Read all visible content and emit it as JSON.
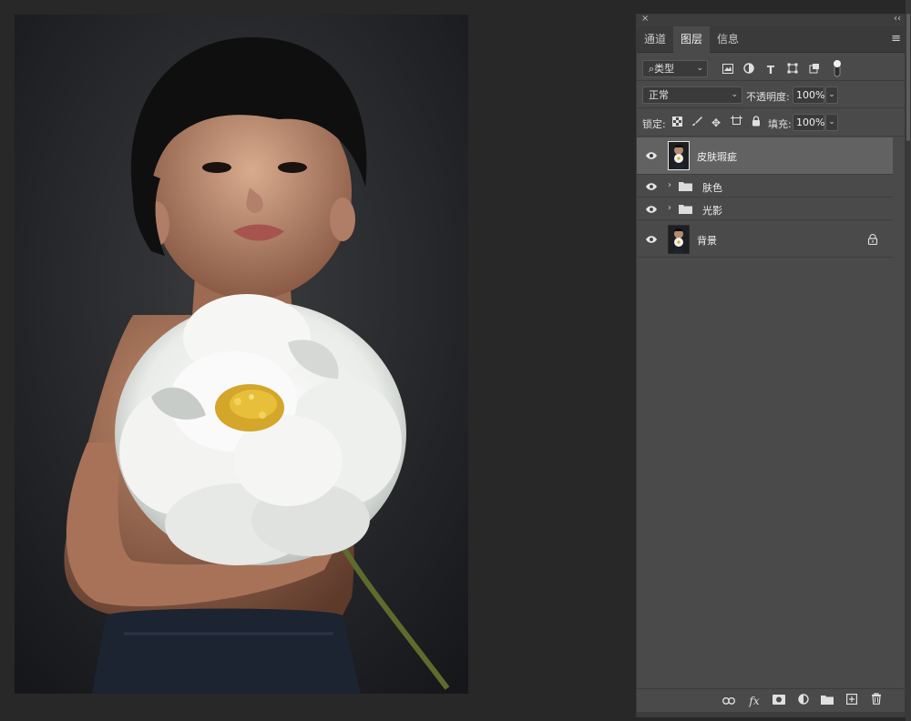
{
  "panel": {
    "close_glyph": "×",
    "collapse_glyph": "‹‹",
    "menu_icon": "hamburger-menu-icon",
    "tabs": [
      {
        "label": "通道",
        "active": false
      },
      {
        "label": "图层",
        "active": true
      },
      {
        "label": "信息",
        "active": false
      }
    ]
  },
  "filter": {
    "kind_label": "类型",
    "icons": [
      "image-filter-icon",
      "adjustment-filter-icon",
      "type-filter-icon",
      "shape-filter-icon",
      "smart-object-filter-icon",
      "filter-toggle-icon"
    ]
  },
  "blend": {
    "mode": "正常",
    "opacity_label": "不透明度:",
    "opacity_value": "100%"
  },
  "lock": {
    "label": "锁定:",
    "icons": [
      "lock-transparent-icon",
      "lock-image-icon",
      "lock-position-icon",
      "lock-artboard-icon",
      "lock-all-icon"
    ],
    "fill_label": "填充:",
    "fill_value": "100%"
  },
  "layers": [
    {
      "name": "皮肤瑕疵",
      "type": "pixel",
      "selected": true,
      "visible": true
    },
    {
      "name": "肤色",
      "type": "group",
      "selected": false,
      "visible": true
    },
    {
      "name": "光影",
      "type": "group",
      "selected": false,
      "visible": true
    },
    {
      "name": "背景",
      "type": "pixel",
      "selected": false,
      "visible": true,
      "locked": true
    }
  ],
  "footer_icons": [
    "link-layers-icon",
    "fx-icon",
    "add-mask-icon",
    "adjustment-layer-icon",
    "new-group-icon",
    "new-layer-icon",
    "delete-layer-icon"
  ],
  "footer_fx_label": "fx",
  "colors": {
    "panel_bg": "#4a4a4a",
    "app_bg": "#282828",
    "selected_row": "#626262"
  }
}
